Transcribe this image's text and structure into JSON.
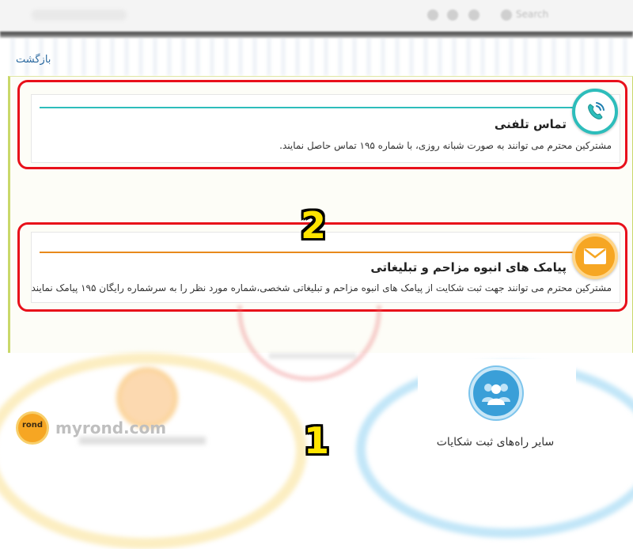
{
  "browser": {
    "search_placeholder": "Search"
  },
  "nav": {
    "back_label": "بازگشت"
  },
  "cards": [
    {
      "title": "تماس تلفنی",
      "description": "مشترکین محترم می توانند به صورت شبانه روزی، با شماره ۱۹۵ تماس حاصل نمایند.",
      "icon": "phone-icon",
      "accent": "#2dbdbb"
    },
    {
      "title": "پیامک های انبوه مزاحم و تبلیغاتی",
      "description": "مشترکین محترم می توانند جهت ثبت شکایت از پیامک های انبوه مزاحم و تبلیغاتی شخصی،شماره مورد نظر را به سرشماره رایگان ۱۹۵ پیامک نمایند",
      "icon": "envelope-icon",
      "accent": "#e88a1c"
    }
  ],
  "annotations": {
    "step_two": "2",
    "step_one": "1",
    "highlight_color": "#e8101a"
  },
  "other_options": {
    "label": "سایر راه‌های ثبت شکایات",
    "icon": "users-group-icon"
  },
  "watermark": {
    "logo_text": "rond",
    "site": "myrond.com"
  }
}
